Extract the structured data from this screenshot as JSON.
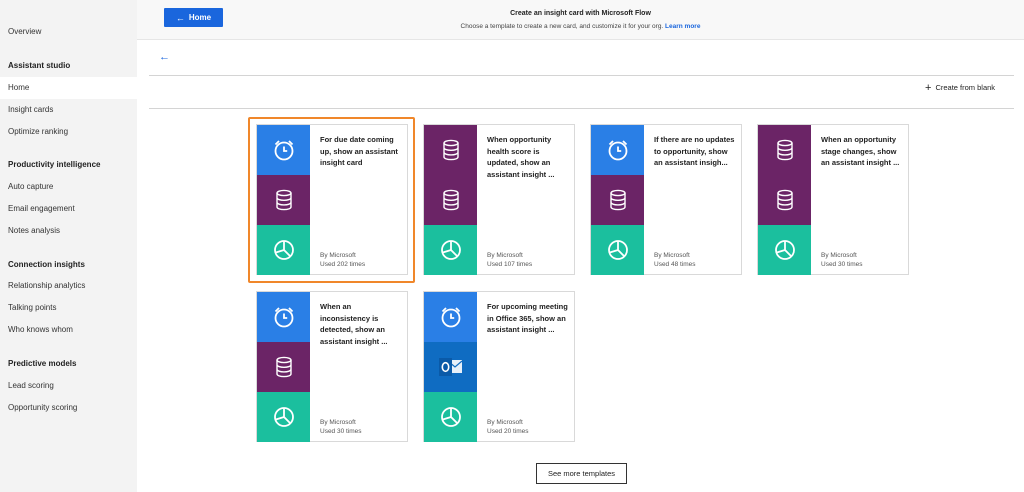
{
  "sidebar": {
    "top": "Overview",
    "sections": [
      {
        "heading": "Assistant studio",
        "items": [
          "Home",
          "Insight cards",
          "Optimize ranking"
        ]
      },
      {
        "heading": "Productivity intelligence",
        "items": [
          "Auto capture",
          "Email engagement",
          "Notes analysis"
        ]
      },
      {
        "heading": "Connection insights",
        "items": [
          "Relationship analytics",
          "Talking points",
          "Who knows whom"
        ]
      },
      {
        "heading": "Predictive models",
        "items": [
          "Lead scoring",
          "Opportunity scoring"
        ]
      }
    ],
    "active_item": "Home"
  },
  "header": {
    "home_label": "Home",
    "title": "Create an insight card with Microsoft Flow",
    "subtitle": "Choose a template to create a new card, and customize it for your org.",
    "learn_more": "Learn more"
  },
  "toolbar": {
    "create_label": "Create from blank"
  },
  "cards": [
    {
      "title": "For due date coming up, show an assistant insight card",
      "by": "By Microsoft",
      "used": "Used 202 times",
      "icons": [
        "alarm-icon",
        "database-icon",
        "pie-chart-icon"
      ],
      "selected": true
    },
    {
      "title": "When opportunity health score is updated, show an assistant insight ...",
      "by": "By Microsoft",
      "used": "Used 107 times",
      "icons": [
        "database-icon",
        "database-icon",
        "pie-chart-icon"
      ]
    },
    {
      "title": "If there are no updates to opportunity, show an assistant insigh...",
      "by": "By Microsoft",
      "used": "Used 48 times",
      "icons": [
        "alarm-icon",
        "database-icon",
        "pie-chart-icon"
      ]
    },
    {
      "title": "When an opportunity stage changes, show an assistant insight ...",
      "by": "By Microsoft",
      "used": "Used 30 times",
      "icons": [
        "database-icon",
        "database-icon",
        "pie-chart-icon"
      ]
    },
    {
      "title": "When an inconsistency is detected, show an assistant insight ...",
      "by": "By Microsoft",
      "used": "Used 30 times",
      "icons": [
        "alarm-icon",
        "database-icon",
        "pie-chart-icon"
      ]
    },
    {
      "title": "For upcoming meeting in Office 365, show an assistant insight ...",
      "by": "By Microsoft",
      "used": "Used 20 times",
      "icons": [
        "alarm-icon",
        "outlook-icon",
        "pie-chart-icon"
      ]
    }
  ],
  "see_more_label": "See more templates",
  "colors": {
    "alarm": "#2a7fe6",
    "database": "#6b2466",
    "pie": "#1bbf9e",
    "outlook": "#0f6cc2",
    "selection": "#f0872a",
    "accent": "#1a66dd"
  }
}
